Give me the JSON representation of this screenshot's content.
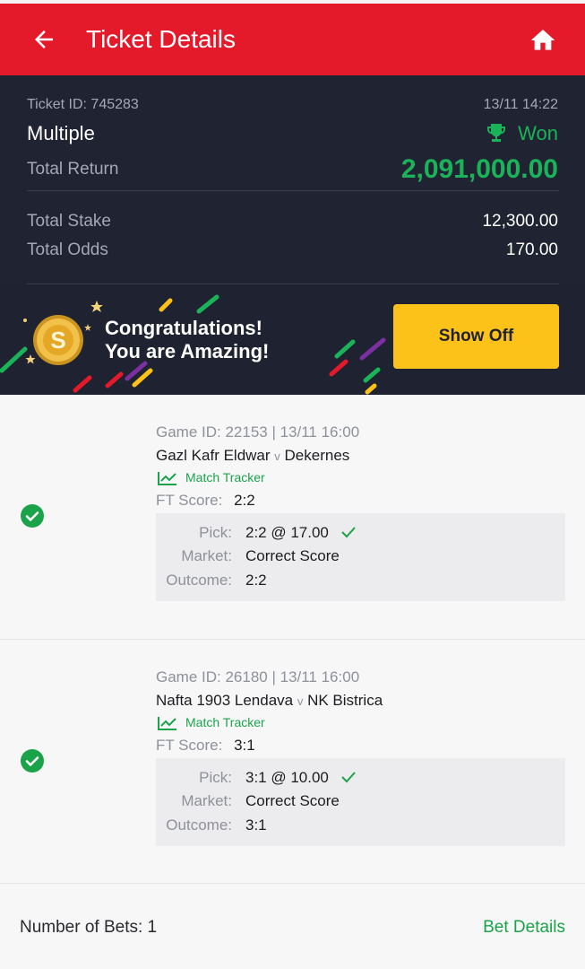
{
  "header": {
    "title": "Ticket Details"
  },
  "ticket": {
    "id_text": "Ticket ID: 745283",
    "datetime": "13/11 14:22",
    "type": "Multiple",
    "status": "Won",
    "total_return_label": "Total Return",
    "total_return": "2,091,000.00",
    "total_stake_label": "Total Stake",
    "total_stake": "12,300.00",
    "total_odds_label": "Total Odds",
    "total_odds": "170.00"
  },
  "promo": {
    "line1": "Congratulations!",
    "line2": "You are Amazing!",
    "button": "Show Off"
  },
  "bets": [
    {
      "game_info": "Game ID: 22153 | 13/11 16:00",
      "home": "Gazl Kafr Eldwar",
      "vs": "v",
      "away": "Dekernes",
      "tracker": "Match Tracker",
      "ft_label": "FT Score:",
      "ft_score": "2:2",
      "pick_label": "Pick:",
      "pick": "2:2 @ 17.00",
      "market_label": "Market:",
      "market": "Correct Score",
      "outcome_label": "Outcome:",
      "outcome": "2:2"
    },
    {
      "game_info": "Game ID: 26180 | 13/11 16:00",
      "home": "Nafta 1903 Lendava",
      "vs": "v",
      "away": "NK Bistrica",
      "tracker": "Match Tracker",
      "ft_label": "FT Score:",
      "ft_score": "3:1",
      "pick_label": "Pick:",
      "pick": "3:1 @ 10.00",
      "market_label": "Market:",
      "market": "Correct Score",
      "outcome_label": "Outcome:",
      "outcome": "3:1"
    }
  ],
  "footer": {
    "num_bets": "Number of Bets: 1",
    "bet_details": "Bet Details"
  },
  "colors": {
    "brand_red": "#e41a2b",
    "dark_panel": "#202331",
    "win_green": "#1bb35a",
    "cta_yellow": "#fdc219"
  },
  "icons": [
    "back-arrow-icon",
    "home-icon",
    "trophy-icon",
    "coin-icon",
    "check-circle-icon",
    "match-tracker-icon",
    "check-icon"
  ]
}
